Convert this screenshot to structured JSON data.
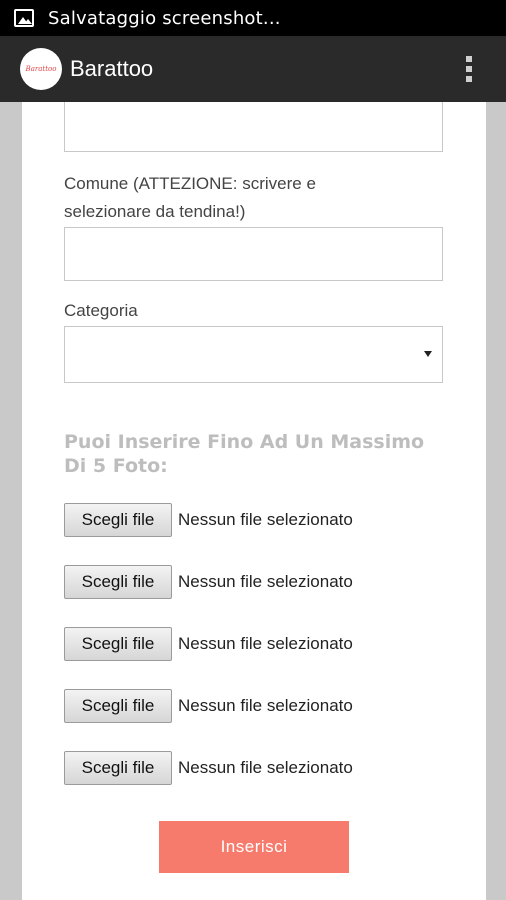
{
  "status_bar": {
    "notification_icon": "image-icon",
    "notification_text": "Salvataggio screenshot..."
  },
  "app_bar": {
    "logo_text": "Barattoo",
    "title": "Barattoo",
    "menu_icon": "overflow-menu-icon"
  },
  "form": {
    "comune_label": "Comune (ATTEZIONE: scrivere e selezionare da tendina!)",
    "comune_value": "",
    "categoria_label": "Categoria",
    "categoria_selected": "",
    "photo_heading": "Puoi Inserire Fino Ad Un Massimo Di 5 Foto:",
    "file_inputs": [
      {
        "button": "Scegli file",
        "status": "Nessun file selezionato"
      },
      {
        "button": "Scegli file",
        "status": "Nessun file selezionato"
      },
      {
        "button": "Scegli file",
        "status": "Nessun file selezionato"
      },
      {
        "button": "Scegli file",
        "status": "Nessun file selezionato"
      },
      {
        "button": "Scegli file",
        "status": "Nessun file selezionato"
      }
    ],
    "submit_label": "Inserisci"
  },
  "colors": {
    "submit_bg": "#f77b6d",
    "app_bar_bg": "#2a2a2a",
    "heading_color": "#bdbdbd"
  }
}
